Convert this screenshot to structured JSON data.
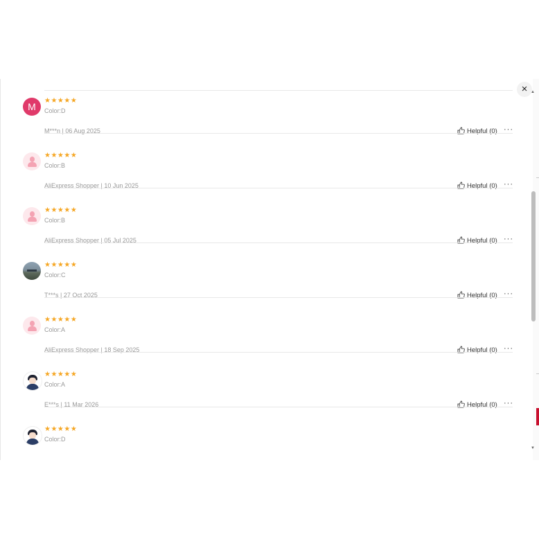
{
  "modal": {
    "close_icon": "close-icon",
    "close_label": "×",
    "scroll_up_glyph": "▲",
    "scroll_down_glyph": "▼"
  },
  "colors": {
    "star": "#f5a623",
    "avatar_m": "#e03a6a",
    "accent": "#c8102e"
  },
  "reviews": [
    {
      "avatar_type": "letter",
      "avatar_letter": "M",
      "stars": "★★★★★",
      "variant": "Color:D",
      "meta": "M***n | 06 Aug 2025",
      "helpful": "Helpful (0)",
      "more": "···"
    },
    {
      "avatar_type": "default",
      "stars": "★★★★★",
      "variant": "Color:B",
      "meta": "AliExpress Shopper | 10 Jun 2025",
      "helpful": "Helpful (0)",
      "more": "···"
    },
    {
      "avatar_type": "default",
      "stars": "★★★★★",
      "variant": "Color:B",
      "meta": "AliExpress Shopper | 05 Jul 2025",
      "helpful": "Helpful (0)",
      "more": "···"
    },
    {
      "avatar_type": "photo",
      "stars": "★★★★★",
      "variant": "Color:C",
      "meta": "T***s | 27 Oct 2025",
      "helpful": "Helpful (0)",
      "more": "···"
    },
    {
      "avatar_type": "default",
      "stars": "★★★★★",
      "variant": "Color:A",
      "meta": "AliExpress Shopper | 18 Sep 2025",
      "helpful": "Helpful (0)",
      "more": "···"
    },
    {
      "avatar_type": "cartoon",
      "stars": "★★★★★",
      "variant": "Color:A",
      "meta": "E***s | 11 Mar 2026",
      "helpful": "Helpful (0)",
      "more": "···"
    },
    {
      "avatar_type": "cartoon",
      "stars": "★★★★★",
      "variant": "Color:D",
      "meta": "",
      "helpful": "",
      "more": ""
    }
  ]
}
